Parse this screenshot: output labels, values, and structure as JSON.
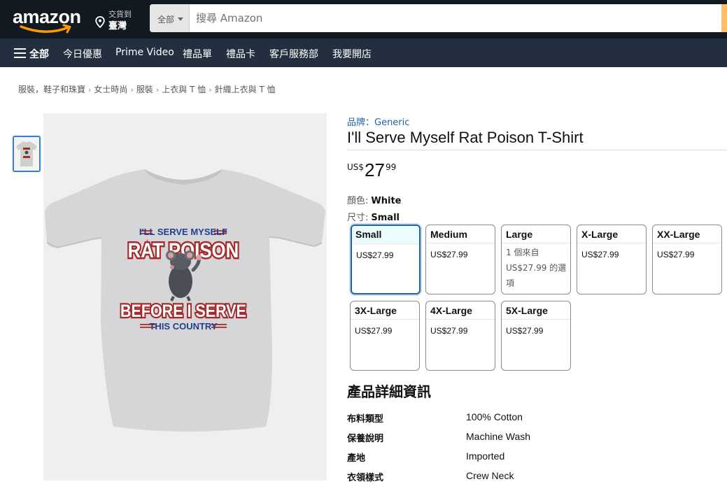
{
  "header": {
    "logo_text": "amazon",
    "deliver_line1": "交貨到",
    "deliver_line2": "臺灣",
    "search_category": "全部",
    "search_placeholder": "搜尋 Amazon",
    "accent_color": "#febd69"
  },
  "nav": {
    "all_label": "全部",
    "items": [
      "今日優惠",
      "Prime Video",
      "禮品單",
      "禮品卡",
      "客戶服務部",
      "我要開店"
    ]
  },
  "breadcrumb": [
    "服裝，鞋子和珠寶",
    "女士時尚",
    "服裝",
    "上衣與 T 恤",
    "針織上衣與 T 恤"
  ],
  "product": {
    "brand": "品牌：Generic",
    "title": "I'll Serve Myself Rat Poison T-Shirt",
    "price_currency": "US$",
    "price_whole": "27",
    "price_fraction": "99",
    "color_label": "顏色:",
    "color_value": "White",
    "size_label": "尺寸:",
    "size_value": "Small",
    "shirt_text": {
      "line1": "I'LL SERVE MYSELF",
      "line2": "RAT POISON",
      "line3": "BEFORE I SERVE",
      "line4": "THIS COUNTRY"
    },
    "sizes": [
      {
        "name": "Small",
        "price": "US$27.99",
        "selected": true
      },
      {
        "name": "Medium",
        "price": "US$27.99"
      },
      {
        "name": "Large",
        "note": "1 個來自",
        "price": "US$27.99 的選項"
      },
      {
        "name": "X-Large",
        "price": "US$27.99"
      },
      {
        "name": "XX-Large",
        "price": "US$27.99"
      },
      {
        "name": "3X-Large",
        "price": "US$27.99"
      },
      {
        "name": "4X-Large",
        "price": "US$27.99"
      },
      {
        "name": "5X-Large",
        "price": "US$27.99"
      }
    ]
  },
  "details": {
    "title": "產品詳細資訊",
    "rows": [
      {
        "key": "布料類型",
        "value": "100% Cotton"
      },
      {
        "key": "保養說明",
        "value": "Machine Wash"
      },
      {
        "key": "產地",
        "value": "Imported"
      },
      {
        "key": "衣領樣式",
        "value": "Crew Neck"
      }
    ]
  }
}
